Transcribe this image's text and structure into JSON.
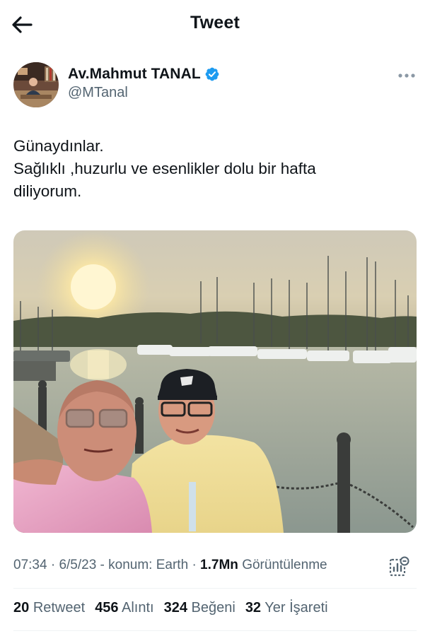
{
  "header": {
    "title": "Tweet",
    "back_icon": "arrow-left-icon"
  },
  "author": {
    "name": "Av.Mahmut TANAL",
    "handle": "@MTanal",
    "verified": true,
    "verified_color": "#1d9bf0"
  },
  "tweet": {
    "lines": [
      "Günaydınlar.",
      "Sağlıklı ,huzurlu ve esenlikler dolu bir hafta",
      "diliyorum."
    ]
  },
  "meta": {
    "time": "07:34",
    "date": "6/5/23",
    "location": "konum: Earth",
    "views_count": "1.7Mn",
    "views_label": "Görüntülenme",
    "analytics_icon": "analytics-icon"
  },
  "stats": [
    {
      "count": "20",
      "label": "Retweet"
    },
    {
      "count": "456",
      "label": "Alıntı"
    },
    {
      "count": "324",
      "label": "Beğeni"
    },
    {
      "count": "32",
      "label": "Yer İşareti"
    }
  ],
  "colors": {
    "text": "#0f1419",
    "secondary": "#536471",
    "divider": "#eff3f4"
  }
}
